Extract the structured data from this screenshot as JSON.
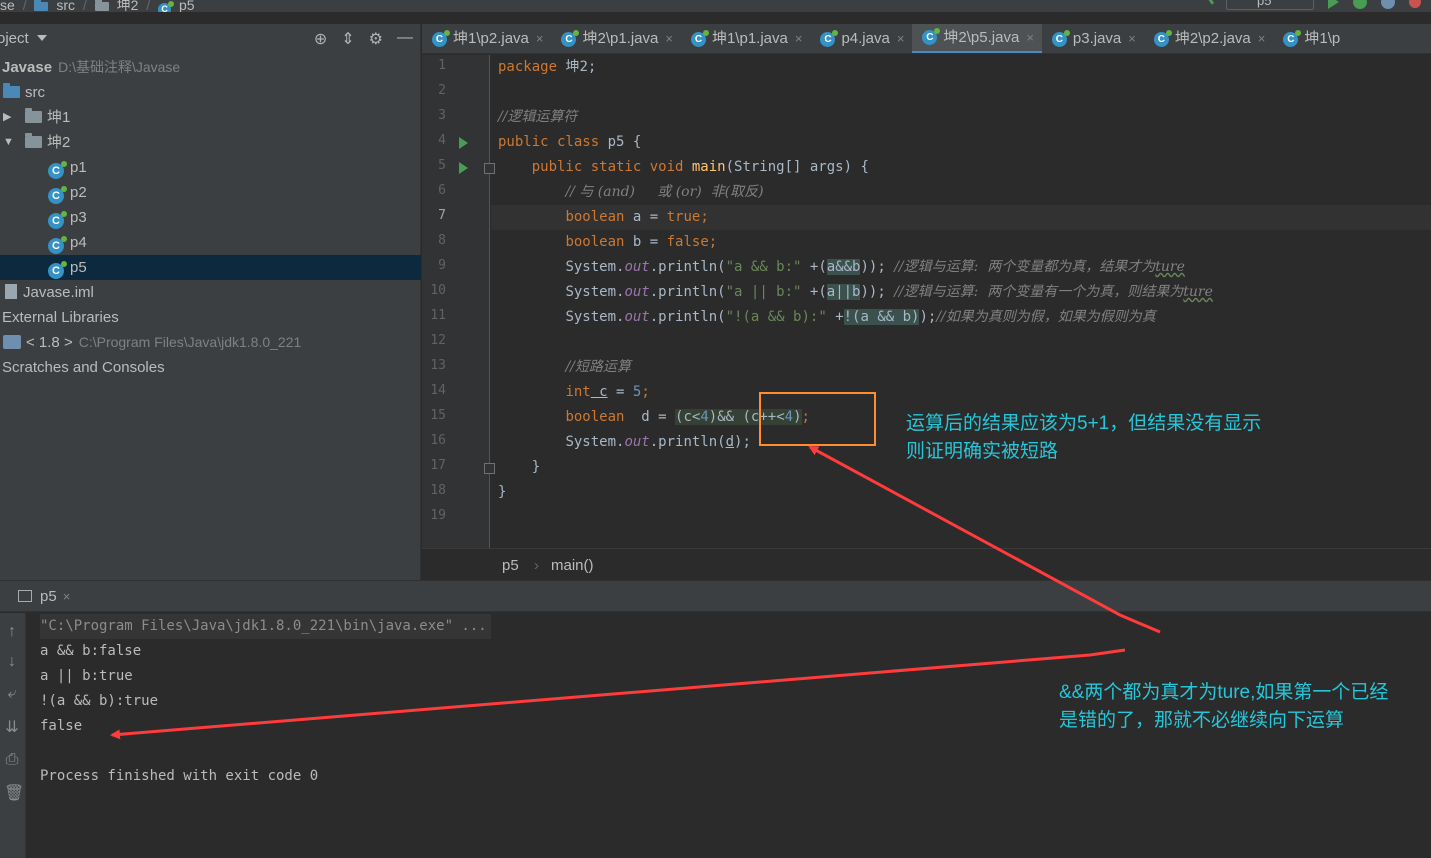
{
  "navbar": {
    "crumbs": [
      "se",
      "src",
      "坤2",
      "p5"
    ],
    "run_config": "p5"
  },
  "project": {
    "title": "roject",
    "tree": [
      {
        "label": "Javase",
        "path": "D:\\基础注释\\Javase"
      },
      {
        "label": "src"
      },
      {
        "label": "坤1"
      },
      {
        "label": "坤2"
      },
      {
        "label": "p1"
      },
      {
        "label": "p2"
      },
      {
        "label": "p3"
      },
      {
        "label": "p4"
      },
      {
        "label": "p5"
      },
      {
        "label": "Javase.iml"
      },
      {
        "label": "External Libraries"
      },
      {
        "label": "< 1.8 >",
        "path": "C:\\Program Files\\Java\\jdk1.8.0_221"
      },
      {
        "label": "Scratches and Consoles"
      }
    ]
  },
  "tabs": [
    "坤1\\p2.java",
    "坤2\\p1.java",
    "坤1\\p1.java",
    "p4.java",
    "坤2\\p5.java",
    "p3.java",
    "坤2\\p2.java",
    "坤1\\p"
  ],
  "editor": {
    "line_numbers": [
      "1",
      "2",
      "3",
      "4",
      "5",
      "6",
      "7",
      "8",
      "9",
      "10",
      "11",
      "12",
      "13",
      "14",
      "15",
      "16",
      "17",
      "18",
      "19"
    ],
    "lines": {
      "l1_kw": "package",
      "l1_rest": " 坤2;",
      "l3": "//逻辑运算符",
      "l4_kw": "public class",
      "l4_rest": " p5 {",
      "l5_kw": "public static void",
      "l5_fn": "main",
      "l5_rest": "(String[] args) {",
      "l6": "// 与 (and)     或 (or)  非(取反)",
      "l7_kw": "boolean",
      "l7_mid": " a = ",
      "l7_val": "true",
      "l7_end": ";",
      "l8_kw": "boolean",
      "l8_mid": " b = ",
      "l8_val": "false",
      "l8_end": ";",
      "l9_a": "System.",
      "l9_out": "out",
      "l9_b": ".println(",
      "l9_str": "\"a && b:\"",
      "l9_c": " +(",
      "l9_hl": "a&&b",
      "l9_d": ")); ",
      "l9_cm": "//逻辑与运算:  两个变量都为真，结果才为",
      "l9_cm2": "ture",
      "l10_a": "System.",
      "l10_out": "out",
      "l10_b": ".println(",
      "l10_str": "\"a || b:\"",
      "l10_c": " +(",
      "l10_hl": "a||b",
      "l10_d": ")); ",
      "l10_cm": "//逻辑与运算:  两个变量有一个为真，则结果为",
      "l10_cm2": "ture",
      "l11_a": "System.",
      "l11_out": "out",
      "l11_b": ".println(",
      "l11_str": "\"!(a && b):\"",
      "l11_c": " +",
      "l11_hl": "!(a && b)",
      "l11_d": ");",
      "l11_cm": "//如果为真则为假，如果为假则为真",
      "l13": "//短路运算",
      "l14_kw": "int",
      "l14_mid": " c",
      "l14_eq": " = ",
      "l14_num": "5",
      "l14_end": ";",
      "l15_kw": "boolean",
      "l15_mid": "  d = ",
      "l15_hl1": "(c<",
      "l15_n1": "4",
      "l15_hl1b": ")&& ",
      "l15_hl2": "(c++<",
      "l15_n2": "4",
      "l15_hl2b": ")",
      "l15_end": ";",
      "l16_a": "System.",
      "l16_out": "out",
      "l16_b": ".println(",
      "l16_d": "d",
      "l16_e": ");",
      "l17": "}",
      "l18": "}"
    }
  },
  "editor_breadcrumb": [
    "p5",
    "main()"
  ],
  "run_tab": "p5",
  "console": [
    "\"C:\\Program Files\\Java\\jdk1.8.0_221\\bin\\java.exe\" ...",
    "a && b:false",
    "a || b:true",
    "!(a && b):true",
    "false",
    "",
    "Process finished with exit code 0"
  ],
  "annotations": {
    "note1": [
      "运算后的结果应该为5+1，但结果没有显示",
      "则证明确实被短路"
    ],
    "note2": [
      "&&两个都为真才为ture,如果第一个已经",
      "是错的了，那就不必继续向下运算"
    ]
  },
  "colors": {
    "annotation_text": "#26c6da",
    "arrow": "#ff3b3b",
    "box": "#ff8c2e",
    "accent": "#4a88c7"
  }
}
